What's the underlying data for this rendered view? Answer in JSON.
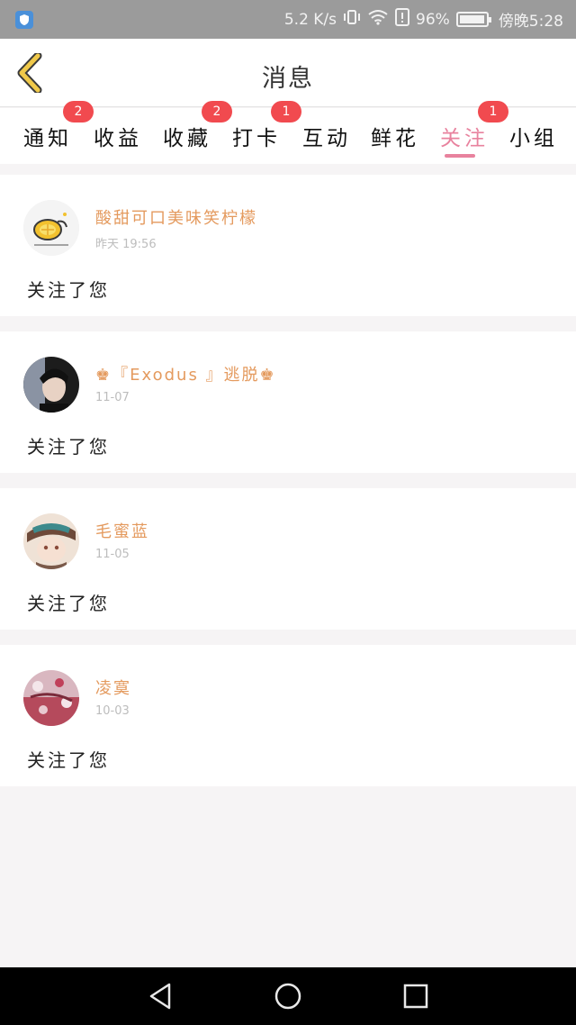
{
  "status_bar": {
    "speed": "5.2 K/s",
    "battery": "96%",
    "battery_level": 0.96,
    "time": "傍晚5:28"
  },
  "header": {
    "title": "消息"
  },
  "tabs": [
    {
      "label": "通知",
      "badge": "2"
    },
    {
      "label": "收益",
      "badge": ""
    },
    {
      "label": "收藏",
      "badge": "2"
    },
    {
      "label": "打卡",
      "badge": "1"
    },
    {
      "label": "互动",
      "badge": ""
    },
    {
      "label": "鲜花",
      "badge": ""
    },
    {
      "label": "关注",
      "badge": "1",
      "active": true
    },
    {
      "label": "小组",
      "badge": ""
    }
  ],
  "notifications": [
    {
      "username": "酸甜可口美味笑柠檬",
      "time": "昨天 19:56",
      "message": "关注了您"
    },
    {
      "username": "♚『Exodus 』逃脱♚",
      "time": "11-07",
      "message": "关注了您"
    },
    {
      "username": "毛蜜蓝",
      "time": "11-05",
      "message": "关注了您"
    },
    {
      "username": "凌寞",
      "time": "10-03",
      "message": "关注了您"
    }
  ],
  "colors": {
    "accent": "#e8829e",
    "username": "#e49a5e",
    "badge": "#f14a4f",
    "back_arrow": "#f0c94a"
  }
}
